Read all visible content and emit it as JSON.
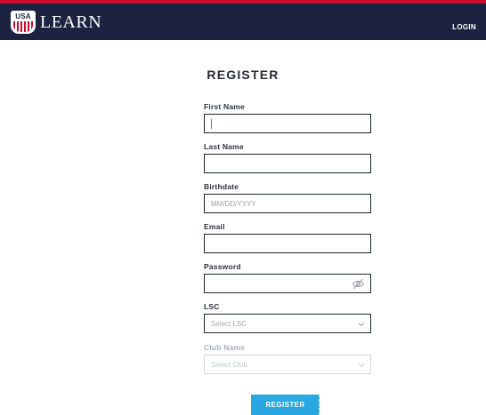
{
  "header": {
    "logo_text": "USA",
    "brand": "LEARN",
    "login_label": "LOGIN"
  },
  "form": {
    "title": "REGISTER",
    "first_name": {
      "label": "First Name",
      "value": ""
    },
    "last_name": {
      "label": "Last Name",
      "value": ""
    },
    "birthdate": {
      "label": "Birthdate",
      "placeholder": "MM/DD/YYYY"
    },
    "email": {
      "label": "Email",
      "value": ""
    },
    "password": {
      "label": "Password",
      "value": ""
    },
    "lsc": {
      "label": "LSC",
      "selected": "Select LSC"
    },
    "club": {
      "label": "Club Name",
      "selected": "Select Club"
    },
    "submit_label": "REGISTER"
  },
  "colors": {
    "header_bg": "#1b2341",
    "header_accent": "#c8102e",
    "button_bg": "#2aa7e1"
  },
  "icons": [
    "usa-swimming-logo-icon",
    "eye-slash-icon",
    "chevron-down-icon"
  ]
}
